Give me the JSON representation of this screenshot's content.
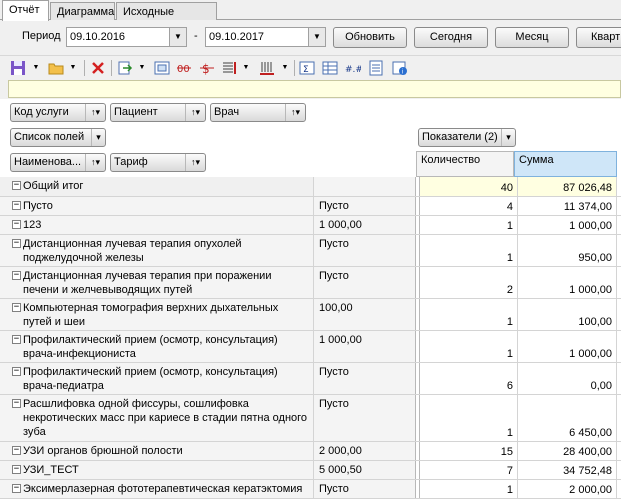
{
  "tabs": [
    {
      "label": "Отчёт",
      "active": true
    },
    {
      "label": "Диаграмма",
      "active": false
    },
    {
      "label": "Исходные данные",
      "active": false
    }
  ],
  "period": {
    "label": "Период",
    "from": "09.10.2016",
    "dash": "-",
    "to": "09.10.2017",
    "dropdown_glyph": "▼"
  },
  "buttons": {
    "refresh": "Обновить",
    "today": "Сегодня",
    "month": "Месяц",
    "quarter": "Кварт"
  },
  "toolbar_icons": [
    "save-icon",
    "open-folder-icon",
    "delete-icon",
    "export-icon",
    "chart-icon",
    "strikethrough-icon",
    "currency-icon",
    "columns-icon",
    "bar-icon",
    "formula-icon",
    "table-icon",
    "dots-icon",
    "list-icon",
    "calendar-icon"
  ],
  "fields": {
    "service_code": "Код услуги",
    "patient": "Пациент",
    "doctor": "Врач",
    "field_list": "Список полей",
    "indicators": "Показатели (2)",
    "name": "Наименова...",
    "tariff": "Тариф",
    "sort_mark": "↑▾"
  },
  "columns": {
    "qty": "Количество",
    "sum": "Сумма"
  },
  "rows": [
    {
      "name": "Общий итог",
      "tariff": "",
      "qty": "40",
      "sum": "87 026,48",
      "total": true
    },
    {
      "name": "Пусто",
      "tariff": "Пусто",
      "qty": "4",
      "sum": "11 374,00"
    },
    {
      "name": "123",
      "tariff": "1 000,00",
      "qty": "1",
      "sum": "1 000,00"
    },
    {
      "name": "Дистанционная лучевая терапия опухолей поджелудочной железы",
      "tariff": "Пусто",
      "qty": "1",
      "sum": "950,00"
    },
    {
      "name": "Дистанционная лучевая терапия при поражении печени и желчевыводящих путей",
      "tariff": "Пусто",
      "qty": "2",
      "sum": "1 000,00"
    },
    {
      "name": "Компьютерная томография верхних дыхательных путей и шеи",
      "tariff": "100,00",
      "qty": "1",
      "sum": "100,00"
    },
    {
      "name": "Профилактический прием (осмотр, консультация) врача-инфекциониста",
      "tariff": "1 000,00",
      "qty": "1",
      "sum": "1 000,00"
    },
    {
      "name": "Профилактический прием (осмотр, консультация) врача-педиатра",
      "tariff": "Пусто",
      "qty": "6",
      "sum": "0,00"
    },
    {
      "name": "Расшлифовка одной фиссуры, сошлифовка некротических масс при кариесе в стадии пятна одного зуба",
      "tariff": "Пусто",
      "qty": "1",
      "sum": "6 450,00"
    },
    {
      "name": "УЗИ органов брюшной полости",
      "tariff": "2 000,00",
      "qty": "15",
      "sum": "28 400,00"
    },
    {
      "name": "УЗИ_ТЕСТ",
      "tariff": "5 000,50",
      "qty": "7",
      "sum": "34 752,48"
    },
    {
      "name": "Эксимерлазерная фототерапевтическая кератэктомия",
      "tariff": "Пусто",
      "qty": "1",
      "sum": "2 000,00"
    }
  ],
  "expander_glyph": "−"
}
